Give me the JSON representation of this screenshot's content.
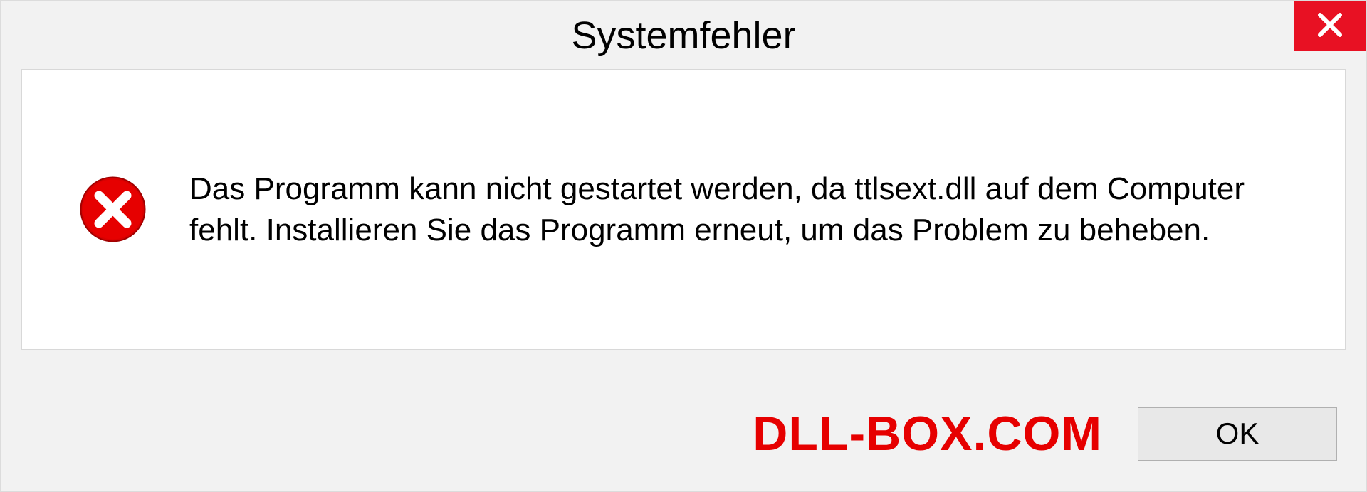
{
  "dialog": {
    "title": "Systemfehler",
    "message": "Das Programm kann nicht gestartet werden, da ttlsext.dll auf dem Computer fehlt. Installieren Sie das Programm erneut, um das Problem zu beheben.",
    "ok_label": "OK"
  },
  "watermark": "DLL-BOX.COM"
}
